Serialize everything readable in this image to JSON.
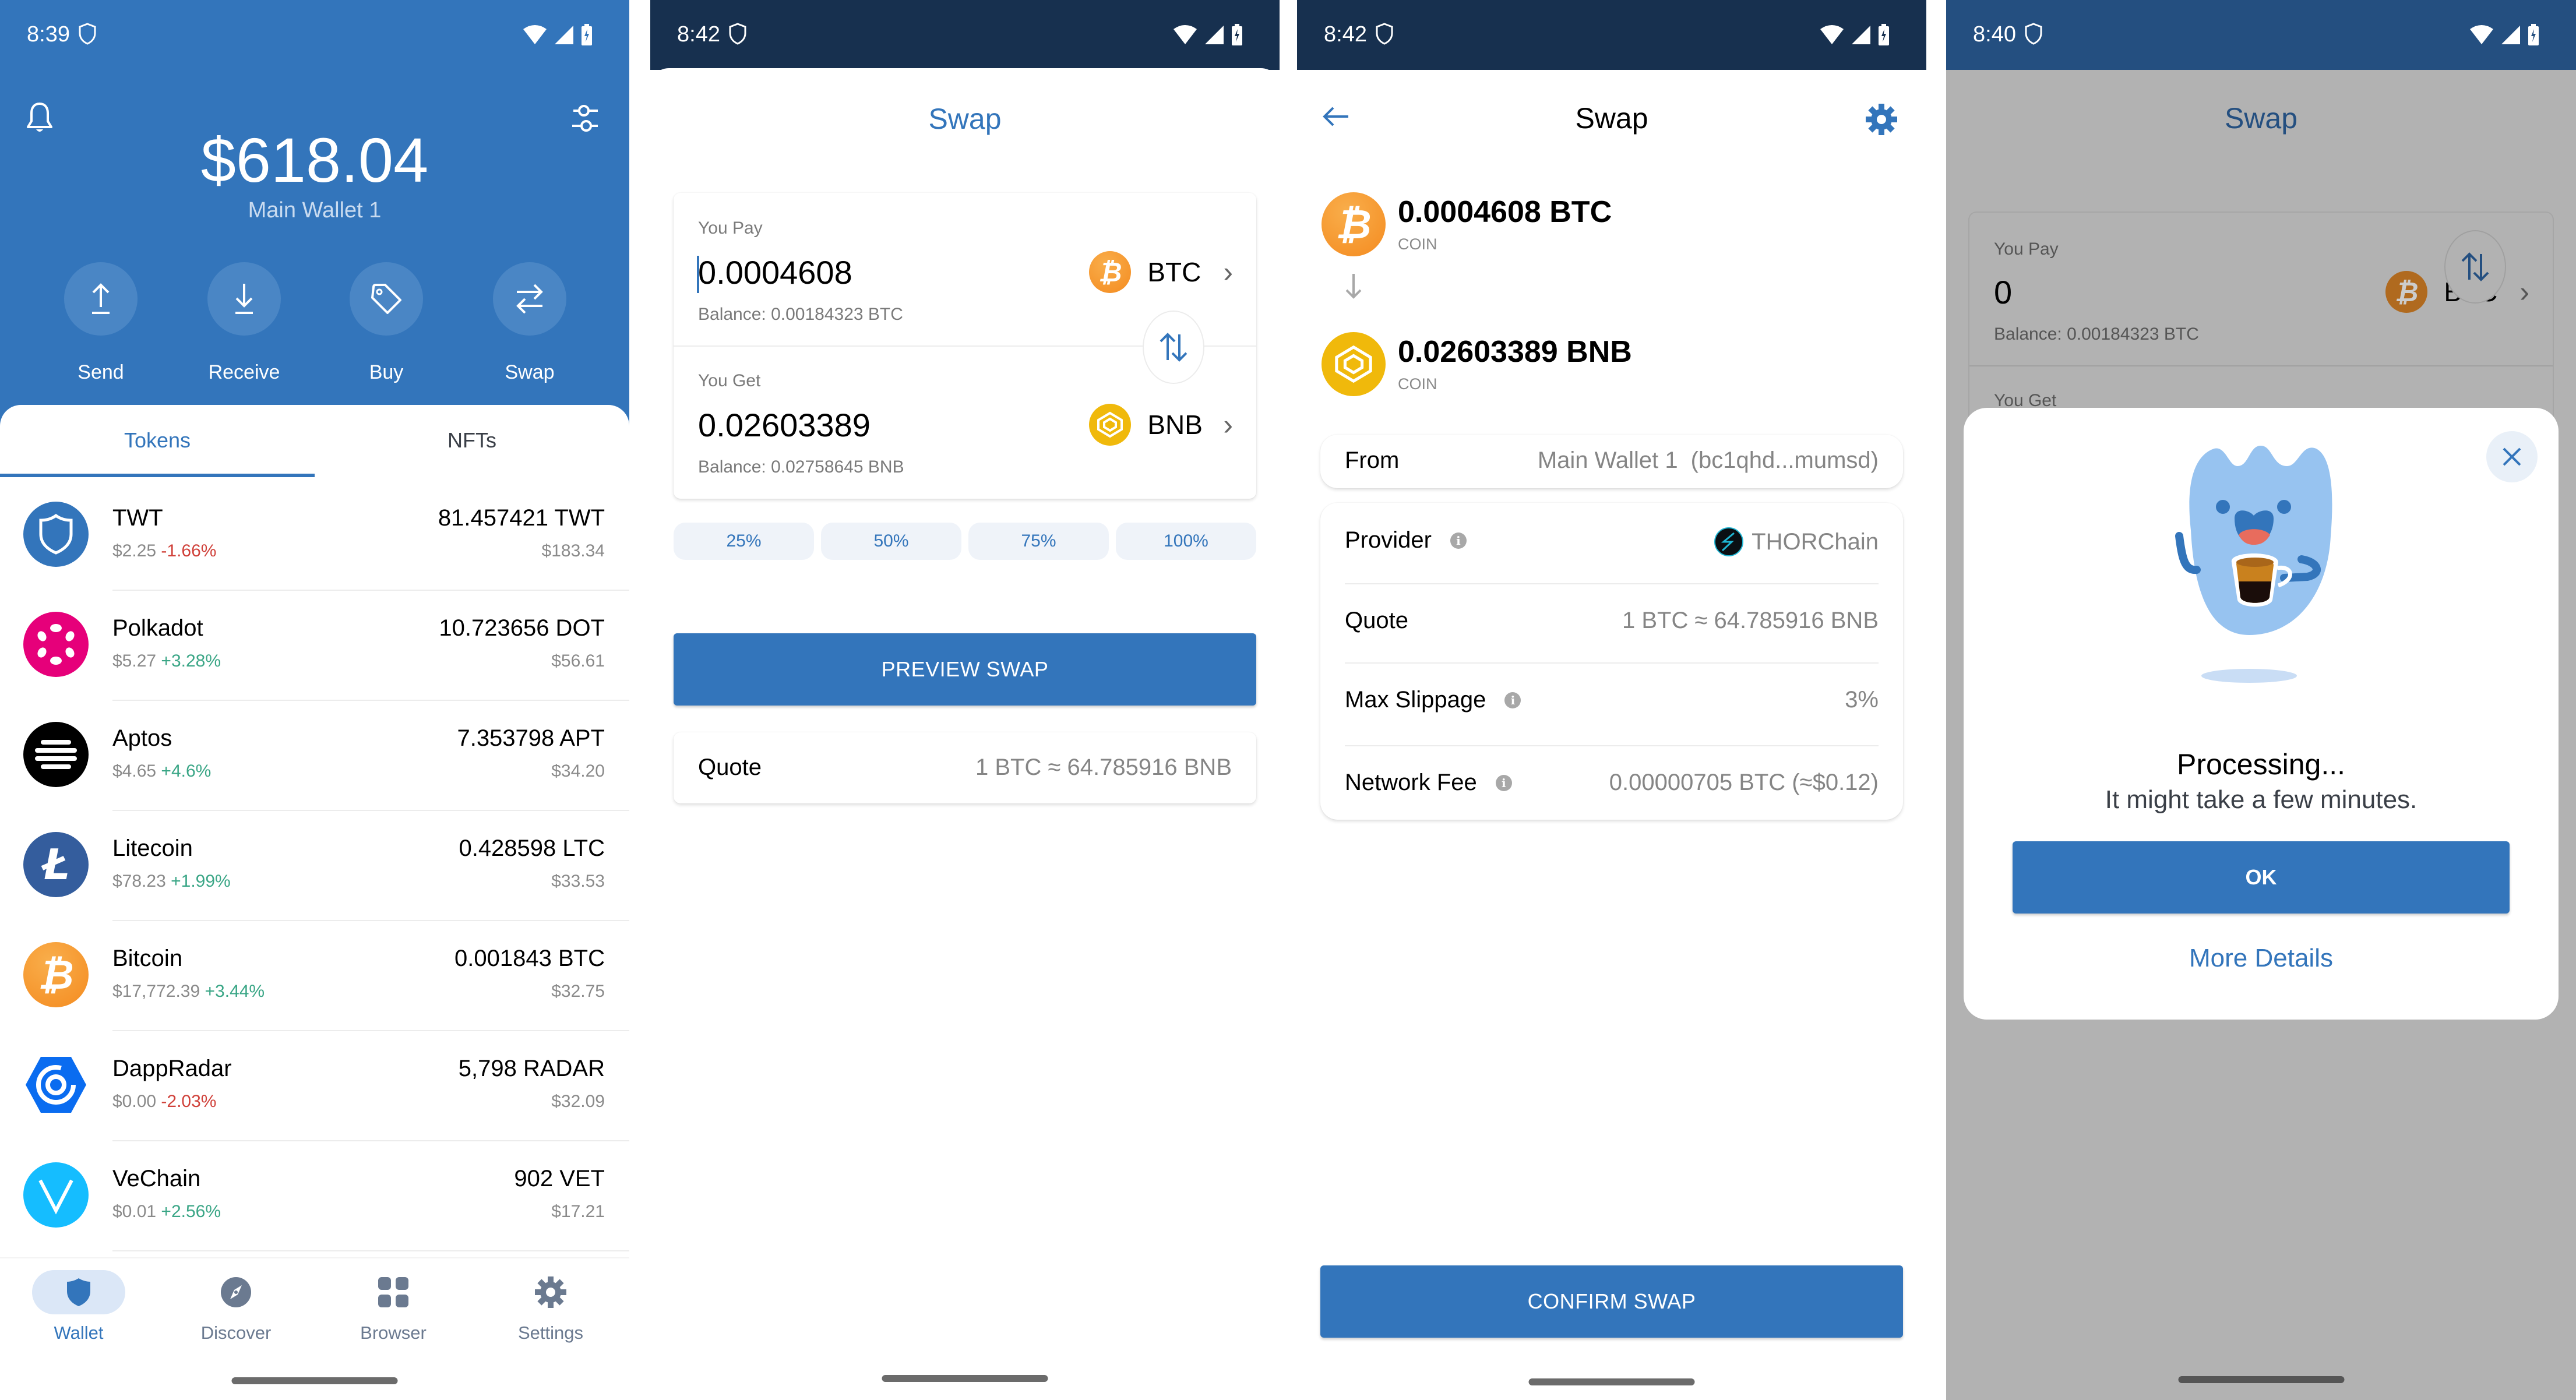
{
  "colors": {
    "brand_blue": "#3375bb",
    "dark_navy": "#17304f",
    "positive": "#3aa686",
    "negative": "#d0413a",
    "btc_orange": "#f7931a",
    "bnb_yellow": "#f0b90b"
  },
  "screens": {
    "wallet": {
      "status": {
        "time": "8:39"
      },
      "balance": "$618.04",
      "wallet_name": "Main Wallet 1",
      "actions": [
        {
          "label": "Send",
          "icon": "arrow-up-icon"
        },
        {
          "label": "Receive",
          "icon": "arrow-down-icon"
        },
        {
          "label": "Buy",
          "icon": "tag-icon"
        },
        {
          "label": "Swap",
          "icon": "swap-arrows-icon"
        }
      ],
      "tabs": [
        {
          "label": "Tokens",
          "active": true
        },
        {
          "label": "NFTs",
          "active": false
        }
      ],
      "tokens": [
        {
          "name": "TWT",
          "price": "$2.25",
          "change": "-1.66%",
          "trend": "negative",
          "amount": "81.457421 TWT",
          "value": "$183.34",
          "icon": "twt-shield-icon"
        },
        {
          "name": "Polkadot",
          "price": "$5.27",
          "change": "+3.28%",
          "trend": "positive",
          "amount": "10.723656 DOT",
          "value": "$56.61",
          "icon": "polkadot-icon"
        },
        {
          "name": "Aptos",
          "price": "$4.65",
          "change": "+4.6%",
          "trend": "positive",
          "amount": "7.353798 APT",
          "value": "$34.20",
          "icon": "aptos-icon"
        },
        {
          "name": "Litecoin",
          "price": "$78.23",
          "change": "+1.99%",
          "trend": "positive",
          "amount": "0.428598 LTC",
          "value": "$33.53",
          "icon": "litecoin-icon"
        },
        {
          "name": "Bitcoin",
          "price": "$17,772.39",
          "change": "+3.44%",
          "trend": "positive",
          "amount": "0.001843 BTC",
          "value": "$32.75",
          "icon": "bitcoin-icon"
        },
        {
          "name": "DappRadar",
          "price": "$0.00",
          "change": "-2.03%",
          "trend": "negative",
          "amount": "5,798 RADAR",
          "value": "$32.09",
          "icon": "dappradar-icon"
        },
        {
          "name": "VeChain",
          "price": "$0.01",
          "change": "+2.56%",
          "trend": "positive",
          "amount": "902 VET",
          "value": "$17.21",
          "icon": "vechain-icon"
        }
      ],
      "nav": [
        {
          "label": "Wallet",
          "active": true,
          "icon": "shield-icon"
        },
        {
          "label": "Discover",
          "active": false,
          "icon": "compass-icon"
        },
        {
          "label": "Browser",
          "active": false,
          "icon": "grid-icon"
        },
        {
          "label": "Settings",
          "active": false,
          "icon": "gear-icon"
        }
      ]
    },
    "swap_form": {
      "status": {
        "time": "8:42"
      },
      "title": "Swap",
      "pay": {
        "label": "You Pay",
        "amount": "0.0004608",
        "symbol": "BTC",
        "balance": "Balance: 0.00184323 BTC"
      },
      "get": {
        "label": "You Get",
        "amount": "0.02603389",
        "symbol": "BNB",
        "balance": "Balance: 0.02758645 BNB"
      },
      "percent_options": [
        "25%",
        "50%",
        "75%",
        "100%"
      ],
      "preview_button": "PREVIEW SWAP",
      "quote": {
        "label": "Quote",
        "value": "1 BTC ≈ 64.785916 BNB"
      }
    },
    "swap_confirm": {
      "status": {
        "time": "8:42"
      },
      "title": "Swap",
      "from_coin": {
        "amount": "0.0004608 BTC",
        "tag": "COIN"
      },
      "to_coin": {
        "amount": "0.02603389 BNB",
        "tag": "COIN"
      },
      "from_row": {
        "label": "From",
        "wallet": "Main Wallet 1",
        "address": "(bc1qhd...mumsd)"
      },
      "details": [
        {
          "label": "Provider",
          "value": "THORChain",
          "info": true,
          "has_logo": true
        },
        {
          "label": "Quote",
          "value": "1 BTC ≈ 64.785916 BNB",
          "info": false
        },
        {
          "label": "Max Slippage",
          "value": "3%",
          "info": true
        },
        {
          "label": "Network Fee",
          "value": "0.00000705 BTC (≈$0.12)",
          "info": true
        }
      ],
      "confirm_button": "CONFIRM SWAP"
    },
    "processing": {
      "status": {
        "time": "8:40"
      },
      "title": "Swap",
      "pay": {
        "label": "You Pay",
        "amount": "0",
        "symbol": "BTC",
        "balance": "Balance: 0.00184323 BTC"
      },
      "get": {
        "label": "You Get"
      },
      "dialog": {
        "title": "Processing...",
        "subtitle": "It might take a few minutes.",
        "ok_button": "OK",
        "more_link": "More Details"
      }
    }
  }
}
